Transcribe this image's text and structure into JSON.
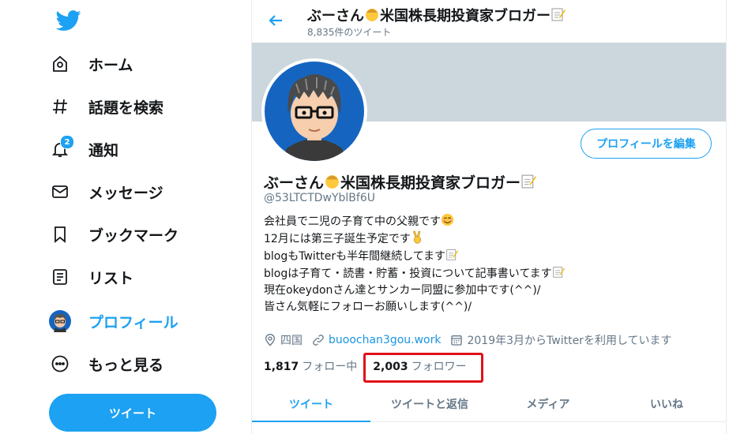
{
  "sidebar": {
    "nav": [
      {
        "label": "ホーム",
        "icon": "home-icon"
      },
      {
        "label": "話題を検索",
        "icon": "hashtag-icon"
      },
      {
        "label": "通知",
        "icon": "bell-icon",
        "badge": "2"
      },
      {
        "label": "メッセージ",
        "icon": "mail-icon"
      },
      {
        "label": "ブックマーク",
        "icon": "bookmark-icon"
      },
      {
        "label": "リスト",
        "icon": "list-icon"
      },
      {
        "label": "プロフィール",
        "icon": "avatar-icon"
      },
      {
        "label": "もっと見る",
        "icon": "more-icon"
      }
    ],
    "tweet_button": "ツイート"
  },
  "header": {
    "title": "ぶーさん",
    "title_rest": "米国株長期投資家ブロガー",
    "tweet_count": "8,835件のツイート"
  },
  "profile": {
    "edit_button": "プロフィールを編集",
    "name": "ぶーさん",
    "name_rest": "米国株長期投資家ブロガー",
    "handle": "@53LTCTDwYblBf6U",
    "bio": [
      "会社員で二児の子育て中の父親です",
      "12月には第三子誕生予定です",
      "blogもTwitterも半年間継続してます",
      "blogは子育て・読書・貯蓄・投資について記事書いてます",
      "現在okeydonさん達とサンカー同盟に参加中です(^^)/",
      "皆さん気軽にフォローお願いします(^^)/"
    ],
    "location": "四国",
    "website": "buoochan3gou.work",
    "joined": "2019年3月からTwitterを利用しています",
    "following_count": "1,817",
    "following_label": "フォロー中",
    "followers_count": "2,003",
    "followers_label": "フォロワー"
  },
  "tabs": [
    "ツイート",
    "ツイートと返信",
    "メディア",
    "いいね"
  ],
  "colors": {
    "accent": "#1da1f2",
    "highlight": "#e0101a",
    "banner": "#ccd6dd"
  }
}
